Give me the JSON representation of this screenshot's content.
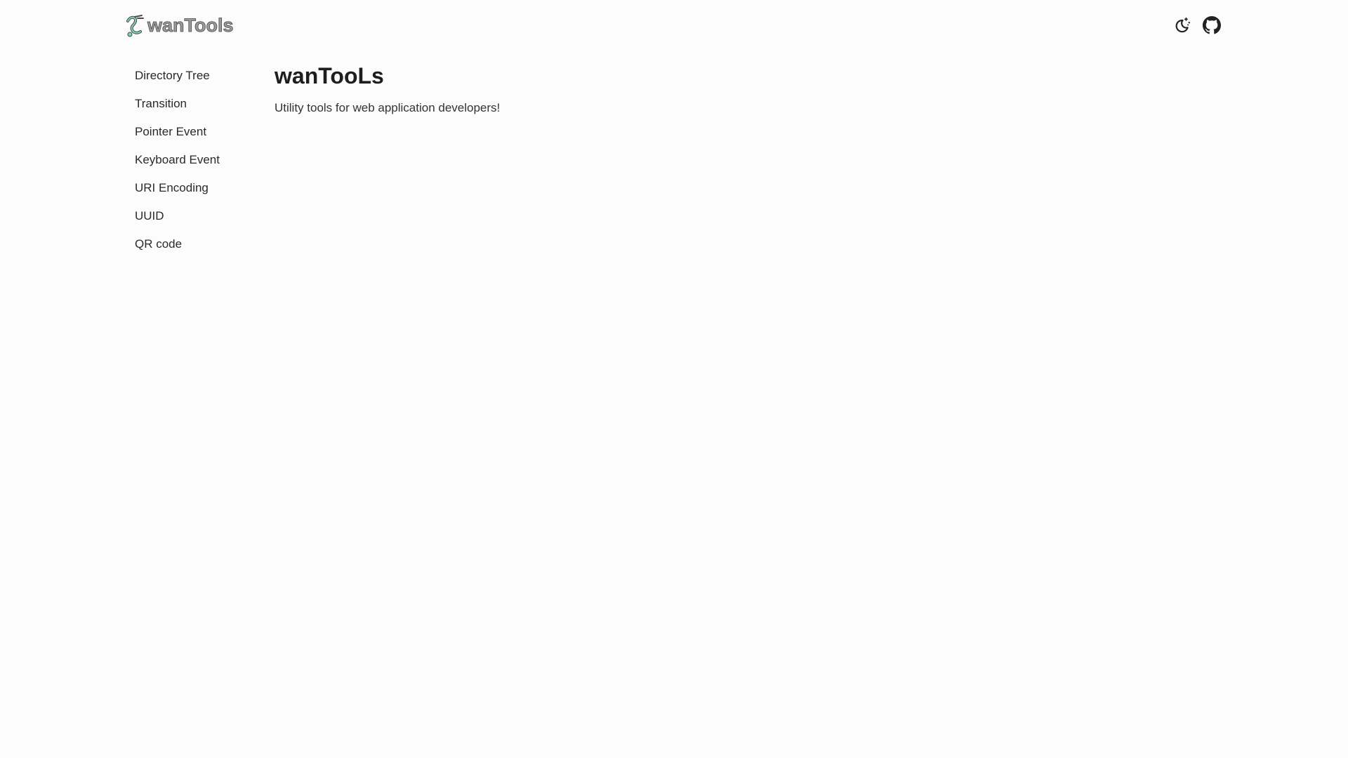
{
  "header": {
    "logo_text": "wanTools",
    "logo_colors": {
      "wordmark": "#8a8a8a",
      "outline": "#4a4a4a",
      "mascot": "#7ed3b2"
    },
    "actions": [
      {
        "icon": "moon-stars-icon",
        "label": "theme-toggle"
      },
      {
        "icon": "github-icon",
        "label": "github-link"
      }
    ]
  },
  "sidebar": {
    "items": [
      {
        "label": "Directory Tree"
      },
      {
        "label": "Transition"
      },
      {
        "label": "Pointer Event"
      },
      {
        "label": "Keyboard Event"
      },
      {
        "label": "URI Encoding"
      },
      {
        "label": "UUID"
      },
      {
        "label": "QR code"
      }
    ]
  },
  "main": {
    "title": "wanTooLs",
    "subtitle": "Utility tools for web application developers!"
  }
}
